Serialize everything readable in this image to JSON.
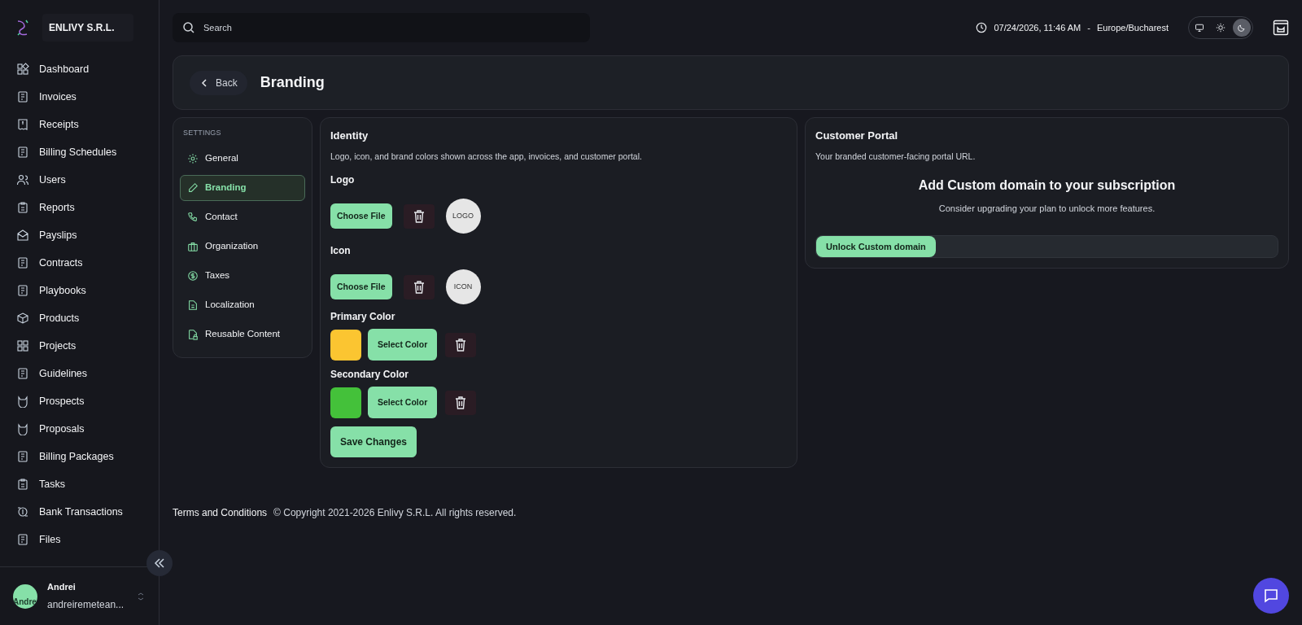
{
  "sidebar": {
    "company": "ENLIVY S.R.L.",
    "items": [
      {
        "label": "Dashboard",
        "kind": "dashboard",
        "selected": false
      },
      {
        "label": "Invoices",
        "kind": "document",
        "selected": false
      },
      {
        "label": "Receipts",
        "kind": "receipt",
        "selected": false
      },
      {
        "label": "Billing Schedules",
        "kind": "document",
        "selected": false
      },
      {
        "label": "Users",
        "kind": "users",
        "selected": false
      },
      {
        "label": "Reports",
        "kind": "clipboard",
        "selected": false
      },
      {
        "label": "Payslips",
        "kind": "envelope",
        "selected": false
      },
      {
        "label": "Contracts",
        "kind": "document",
        "selected": false
      },
      {
        "label": "Playbooks",
        "kind": "document",
        "selected": false
      },
      {
        "label": "Products",
        "kind": "box",
        "selected": false
      },
      {
        "label": "Projects",
        "kind": "grid",
        "selected": false
      },
      {
        "label": "Guidelines",
        "kind": "document",
        "selected": false
      },
      {
        "label": "Prospects",
        "kind": "cat",
        "selected": false
      },
      {
        "label": "Proposals",
        "kind": "cat",
        "selected": false
      },
      {
        "label": "Billing Packages",
        "kind": "document",
        "selected": false
      },
      {
        "label": "Tasks",
        "kind": "clipboard",
        "selected": false
      },
      {
        "label": "Bank Transactions",
        "kind": "coin",
        "selected": false
      },
      {
        "label": "Files",
        "kind": "document",
        "selected": false
      }
    ],
    "user": {
      "avatar_text": "Andre",
      "name": "Andrei",
      "email": "andreiremetean..."
    }
  },
  "topbar": {
    "search": {
      "placeholder": "Search"
    },
    "datetime": "07/24/2026, 11:46 AM",
    "separator": "-",
    "timezone": "Europe/Bucharest",
    "theme_modes": [
      {
        "kind": "system",
        "selected": false
      },
      {
        "kind": "light",
        "selected": false
      },
      {
        "kind": "dark",
        "selected": true
      }
    ]
  },
  "header": {
    "back": "Back",
    "title": "Branding"
  },
  "settings_nav": {
    "heading": "SETTINGS",
    "items": [
      {
        "label": "General",
        "kind": "gear",
        "selected": false
      },
      {
        "label": "Branding",
        "kind": "pencil",
        "selected": true
      },
      {
        "label": "Contact",
        "kind": "phone",
        "selected": false
      },
      {
        "label": "Organization",
        "kind": "briefcase",
        "selected": false
      },
      {
        "label": "Taxes",
        "kind": "dollar",
        "selected": false
      },
      {
        "label": "Localization",
        "kind": "file",
        "selected": false
      },
      {
        "label": "Reusable Content",
        "kind": "file-lock",
        "selected": false
      }
    ]
  },
  "identity": {
    "title": "Identity",
    "description": "Logo, icon, and brand colors shown across the app, invoices, and customer portal.",
    "uploads": [
      {
        "label": "Logo",
        "button": "Choose File",
        "preview": "LOGO"
      },
      {
        "label": "Icon",
        "button": "Choose File",
        "preview": "ICON"
      }
    ],
    "colors": [
      {
        "label": "Primary Color",
        "color": "#fbc531",
        "button": "Select Color"
      },
      {
        "label": "Secondary Color",
        "color": "#44c13a",
        "button": "Select Color"
      }
    ],
    "save": "Save Changes"
  },
  "portal": {
    "title": "Customer Portal",
    "description": "Your branded customer-facing portal URL.",
    "upsell_title": "Add Custom domain to your subscription",
    "upsell_text": "Consider upgrading your plan to unlock more features.",
    "button": "Unlock Custom domain"
  },
  "footer": {
    "link": "Terms and Conditions",
    "copyright": "© Copyright 2021-2026 Enlivy S.R.L. All rights reserved."
  }
}
